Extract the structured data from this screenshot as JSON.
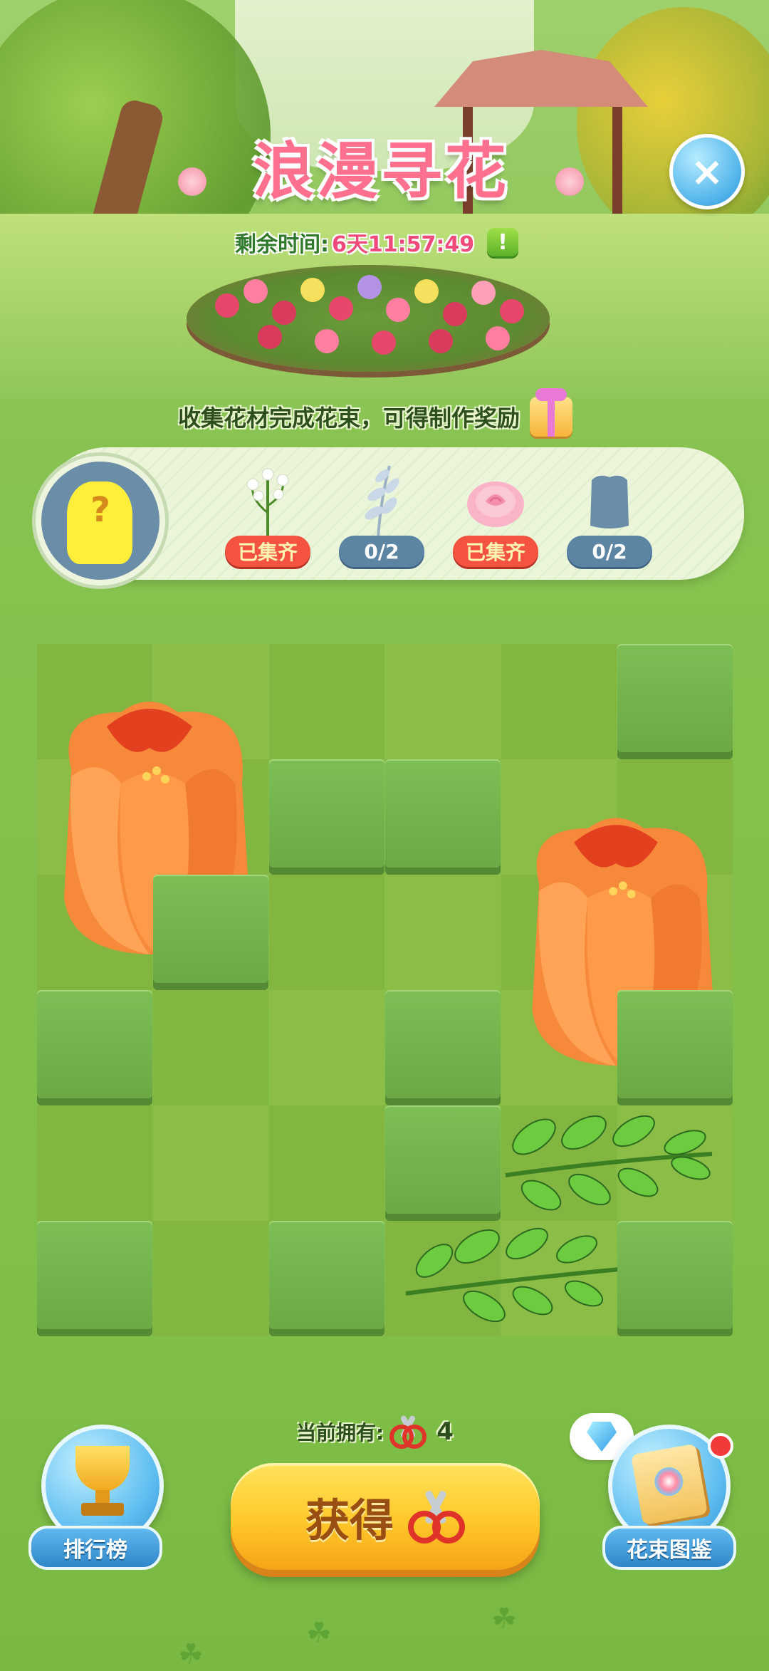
{
  "event": {
    "title": "浪漫寻花",
    "timer_label": "剩余时间:",
    "timer_value": "6天11:57:49",
    "timer_badge": "!"
  },
  "close_button": "×",
  "collect_hint": "收集花材完成花束，可得制作奖励",
  "bouquet": {
    "mystery_mark": "?",
    "slots": [
      {
        "icon": "lily-of-the-valley-icon",
        "status": "已集齐"
      },
      {
        "icon": "silver-leaf-icon",
        "status": "0/2"
      },
      {
        "icon": "pink-rose-icon",
        "status": "已集齐"
      },
      {
        "icon": "hidden-material-icon",
        "status": "0/2"
      }
    ]
  },
  "board": {
    "rows": 6,
    "cols": 6
  },
  "owned": {
    "label": "当前拥有:",
    "count": "4"
  },
  "get_button": "获得",
  "leaderboard_button": "排行榜",
  "bouquet_book_button": "花束图鉴",
  "colors": {
    "accent_pink": "#ff6f8e",
    "done_red": "#f4533f",
    "count_blue": "#5c84a3",
    "button_yellow": "#ffc72a"
  }
}
